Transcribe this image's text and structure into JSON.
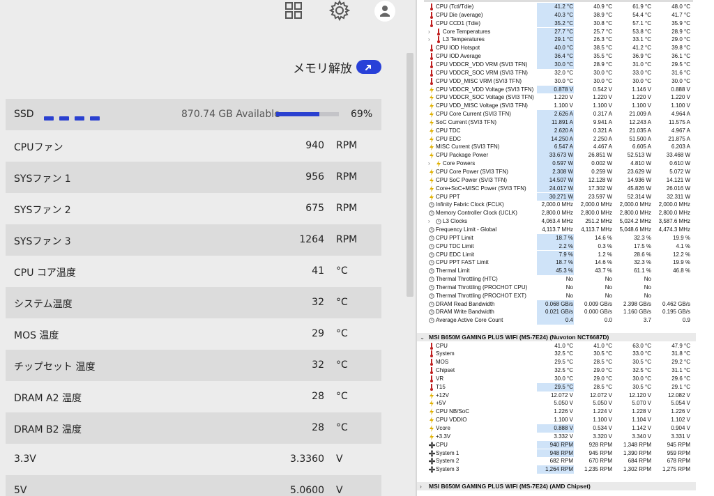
{
  "left": {
    "memory_release_label": "メモリ解放",
    "ssd": {
      "label": "SSD",
      "available": "870.74 GB Available",
      "percent": "69%",
      "fill_fraction": 0.69
    },
    "rows": [
      {
        "label": "CPUファン",
        "value": "940",
        "unit": "RPM"
      },
      {
        "label": "SYSファン 1",
        "value": "956",
        "unit": "RPM"
      },
      {
        "label": "SYSファン 2",
        "value": "675",
        "unit": "RPM"
      },
      {
        "label": "SYSファン 3",
        "value": "1264",
        "unit": "RPM"
      },
      {
        "label": "CPU コア温度",
        "value": "41",
        "unit": "°C"
      },
      {
        "label": "システム温度",
        "value": "32",
        "unit": "°C"
      },
      {
        "label": "MOS 温度",
        "value": "29",
        "unit": "°C"
      },
      {
        "label": "チップセット 温度",
        "value": "32",
        "unit": "°C"
      },
      {
        "label": "DRAM A2 温度",
        "value": "28",
        "unit": "°C"
      },
      {
        "label": "DRAM B2 温度",
        "value": "28",
        "unit": "°C"
      },
      {
        "label": "3.3V",
        "value": "3.3360",
        "unit": "V"
      },
      {
        "label": "5V",
        "value": "5.0600",
        "unit": "V"
      }
    ],
    "icons": [
      "grid-icon",
      "gear-icon",
      "user-avatar-icon",
      "upload-arrow-icon"
    ]
  },
  "right": {
    "cpu_rows": [
      {
        "label": "CPU (Tctl/Tdie)",
        "icon": "thermometer",
        "v": [
          "41.2 °C",
          "40.9 °C",
          "61.9 °C",
          "48.0 °C"
        ],
        "hl": true
      },
      {
        "label": "CPU Die (average)",
        "icon": "thermometer",
        "v": [
          "40.3 °C",
          "38.9 °C",
          "54.4 °C",
          "41.7 °C"
        ],
        "hl": true
      },
      {
        "label": "CPU CCD1 (Tdie)",
        "icon": "thermometer",
        "v": [
          "35.2 °C",
          "30.8 °C",
          "57.1 °C",
          "35.9 °C"
        ],
        "hl": true
      },
      {
        "label": "Core Temperatures",
        "icon": "thermometer",
        "exp": true,
        "v": [
          "27.7 °C",
          "25.7 °C",
          "53.8 °C",
          "28.9 °C"
        ],
        "hl": true
      },
      {
        "label": "L3 Temperatures",
        "icon": "thermometer",
        "exp": true,
        "v": [
          "29.1 °C",
          "26.3 °C",
          "33.1 °C",
          "29.0 °C"
        ],
        "hl": true
      },
      {
        "label": "CPU IOD Hotspot",
        "icon": "thermometer",
        "v": [
          "40.0 °C",
          "38.5 °C",
          "41.2 °C",
          "39.8 °C"
        ],
        "hl": true
      },
      {
        "label": "CPU IOD Average",
        "icon": "thermometer",
        "v": [
          "36.4 °C",
          "35.5 °C",
          "36.9 °C",
          "36.1 °C"
        ],
        "hl": true
      },
      {
        "label": "CPU VDDCR_VDD VRM (SVI3 TFN)",
        "icon": "thermometer",
        "v": [
          "30.0 °C",
          "28.9 °C",
          "31.0 °C",
          "29.5 °C"
        ],
        "hl": true
      },
      {
        "label": "CPU VDDCR_SOC VRM (SVI3 TFN)",
        "icon": "thermometer",
        "v": [
          "32.0 °C",
          "30.0 °C",
          "33.0 °C",
          "31.6 °C"
        ],
        "hl": false
      },
      {
        "label": "CPU VDD_MISC VRM (SVI3 TFN)",
        "icon": "thermometer",
        "v": [
          "30.0 °C",
          "30.0 °C",
          "30.0 °C",
          "30.0 °C"
        ],
        "hl": false
      },
      {
        "label": "CPU VDDCR_VDD Voltage (SVI3 TFN)",
        "icon": "bolt",
        "v": [
          "0.878 V",
          "0.542 V",
          "1.146 V",
          "0.888 V"
        ],
        "hl": true
      },
      {
        "label": "CPU VDDCR_SOC Voltage (SVI3 TFN)",
        "icon": "bolt",
        "v": [
          "1.220 V",
          "1.220 V",
          "1.220 V",
          "1.220 V"
        ],
        "hl": false
      },
      {
        "label": "CPU VDD_MISC Voltage (SVI3 TFN)",
        "icon": "bolt",
        "v": [
          "1.100 V",
          "1.100 V",
          "1.100 V",
          "1.100 V"
        ],
        "hl": false
      },
      {
        "label": "CPU Core Current (SVI3 TFN)",
        "icon": "bolt",
        "v": [
          "2.626 A",
          "0.317 A",
          "21.009 A",
          "4.964 A"
        ],
        "hl": true
      },
      {
        "label": "SoC Current (SVI3 TFN)",
        "icon": "bolt",
        "v": [
          "11.891 A",
          "9.941 A",
          "12.243 A",
          "11.575 A"
        ],
        "hl": true
      },
      {
        "label": "CPU TDC",
        "icon": "bolt",
        "v": [
          "2.620 A",
          "0.321 A",
          "21.035 A",
          "4.967 A"
        ],
        "hl": true
      },
      {
        "label": "CPU EDC",
        "icon": "bolt",
        "v": [
          "14.250 A",
          "2.250 A",
          "51.500 A",
          "21.875 A"
        ],
        "hl": true
      },
      {
        "label": "MISC Current (SVI3 TFN)",
        "icon": "bolt",
        "v": [
          "6.547 A",
          "4.467 A",
          "6.605 A",
          "6.203 A"
        ],
        "hl": true
      },
      {
        "label": "CPU Package Power",
        "icon": "bolt",
        "v": [
          "33.673 W",
          "26.851 W",
          "52.513 W",
          "33.468 W"
        ],
        "hl": true
      },
      {
        "label": "Core Powers",
        "icon": "bolt",
        "exp": true,
        "v": [
          "0.597 W",
          "0.002 W",
          "4.810 W",
          "0.610 W"
        ],
        "hl": true
      },
      {
        "label": "CPU Core Power (SVI3 TFN)",
        "icon": "bolt",
        "v": [
          "2.308 W",
          "0.259 W",
          "23.629 W",
          "5.072 W"
        ],
        "hl": true
      },
      {
        "label": "CPU SoC Power (SVI3 TFN)",
        "icon": "bolt",
        "v": [
          "14.507 W",
          "12.128 W",
          "14.936 W",
          "14.121 W"
        ],
        "hl": true
      },
      {
        "label": "Core+SoC+MISC Power (SVI3 TFN)",
        "icon": "bolt",
        "v": [
          "24.017 W",
          "17.302 W",
          "45.826 W",
          "26.016 W"
        ],
        "hl": true
      },
      {
        "label": "CPU PPT",
        "icon": "bolt",
        "v": [
          "30.271 W",
          "23.597 W",
          "52.314 W",
          "32.311 W"
        ],
        "hl": true
      },
      {
        "label": "Infinity Fabric Clock (FCLK)",
        "icon": "clock",
        "v": [
          "2,000.0 MHz",
          "2,000.0 MHz",
          "2,000.0 MHz",
          "2,000.0 MHz"
        ],
        "hl": false
      },
      {
        "label": "Memory Controller Clock (UCLK)",
        "icon": "clock",
        "v": [
          "2,800.0 MHz",
          "2,800.0 MHz",
          "2,800.0 MHz",
          "2,800.0 MHz"
        ],
        "hl": false
      },
      {
        "label": "L3 Clocks",
        "icon": "clock",
        "exp": true,
        "v": [
          "4,063.4 MHz",
          "251.2 MHz",
          "5,024.2 MHz",
          "3,587.6 MHz"
        ],
        "hl": false
      },
      {
        "label": "Frequency Limit - Global",
        "icon": "clock",
        "v": [
          "4,113.7 MHz",
          "4,113.7 MHz",
          "5,048.6 MHz",
          "4,474.3 MHz"
        ],
        "hl": false
      },
      {
        "label": "CPU PPT Limit",
        "icon": "clock",
        "v": [
          "18.7 %",
          "14.6 %",
          "32.3 %",
          "19.9 %"
        ],
        "hl": true
      },
      {
        "label": "CPU TDC Limit",
        "icon": "clock",
        "v": [
          "2.2 %",
          "0.3 %",
          "17.5 %",
          "4.1 %"
        ],
        "hl": true
      },
      {
        "label": "CPU EDC Limit",
        "icon": "clock",
        "v": [
          "7.9 %",
          "1.2 %",
          "28.6 %",
          "12.2 %"
        ],
        "hl": true
      },
      {
        "label": "CPU PPT FAST Limit",
        "icon": "clock",
        "v": [
          "18.7 %",
          "14.6 %",
          "32.3 %",
          "19.9 %"
        ],
        "hl": true
      },
      {
        "label": "Thermal Limit",
        "icon": "clock",
        "v": [
          "45.3 %",
          "43.7 %",
          "61.1 %",
          "46.8 %"
        ],
        "hl": true
      },
      {
        "label": "Thermal Throttling (HTC)",
        "icon": "clock",
        "v": [
          "No",
          "No",
          "No",
          ""
        ],
        "hl": false
      },
      {
        "label": "Thermal Throttling (PROCHOT CPU)",
        "icon": "clock",
        "v": [
          "No",
          "No",
          "No",
          ""
        ],
        "hl": false
      },
      {
        "label": "Thermal Throttling (PROCHOT EXT)",
        "icon": "clock",
        "v": [
          "No",
          "No",
          "No",
          ""
        ],
        "hl": false
      },
      {
        "label": "DRAM Read Bandwidth",
        "icon": "clock",
        "v": [
          "0.068 GB/s",
          "0.009 GB/s",
          "2.398 GB/s",
          "0.462 GB/s"
        ],
        "hl": true
      },
      {
        "label": "DRAM Write Bandwidth",
        "icon": "clock",
        "v": [
          "0.021 GB/s",
          "0.000 GB/s",
          "1.160 GB/s",
          "0.195 GB/s"
        ],
        "hl": true
      },
      {
        "label": "Average Active Core Count",
        "icon": "clock",
        "v": [
          "0.4",
          "0.0",
          "3.7",
          "0.9"
        ],
        "hl": true
      }
    ],
    "mb_header": "MSI B650M GAMING PLUS WIFI (MS-7E24) (Nuvoton NCT6687D)",
    "mb_rows": [
      {
        "label": "CPU",
        "icon": "thermometer",
        "v": [
          "41.0 °C",
          "41.0 °C",
          "63.0 °C",
          "47.9 °C"
        ],
        "hl": false
      },
      {
        "label": "System",
        "icon": "thermometer",
        "v": [
          "32.5 °C",
          "30.5 °C",
          "33.0 °C",
          "31.8 °C"
        ],
        "hl": false
      },
      {
        "label": "MOS",
        "icon": "thermometer",
        "v": [
          "29.5 °C",
          "28.5 °C",
          "30.5 °C",
          "29.2 °C"
        ],
        "hl": false
      },
      {
        "label": "Chipset",
        "icon": "thermometer",
        "v": [
          "32.5 °C",
          "29.0 °C",
          "32.5 °C",
          "31.1 °C"
        ],
        "hl": false
      },
      {
        "label": "VR",
        "icon": "thermometer",
        "v": [
          "30.0 °C",
          "29.0 °C",
          "30.0 °C",
          "29.6 °C"
        ],
        "hl": false
      },
      {
        "label": "T15",
        "icon": "thermometer",
        "v": [
          "29.5 °C",
          "28.5 °C",
          "30.5 °C",
          "29.1 °C"
        ],
        "hl": true
      },
      {
        "label": "+12V",
        "icon": "bolt",
        "v": [
          "12.072 V",
          "12.072 V",
          "12.120 V",
          "12.082 V"
        ],
        "hl": false
      },
      {
        "label": "+5V",
        "icon": "bolt",
        "v": [
          "5.050 V",
          "5.050 V",
          "5.070 V",
          "5.054 V"
        ],
        "hl": false
      },
      {
        "label": "CPU NB/SoC",
        "icon": "bolt",
        "v": [
          "1.226 V",
          "1.224 V",
          "1.228 V",
          "1.226 V"
        ],
        "hl": false
      },
      {
        "label": "CPU VDDIO",
        "icon": "bolt",
        "v": [
          "1.100 V",
          "1.100 V",
          "1.104 V",
          "1.102 V"
        ],
        "hl": false
      },
      {
        "label": "Vcore",
        "icon": "bolt",
        "v": [
          "0.888 V",
          "0.534 V",
          "1.142 V",
          "0.904 V"
        ],
        "hl": true
      },
      {
        "label": "+3.3V",
        "icon": "bolt",
        "v": [
          "3.332 V",
          "3.320 V",
          "3.340 V",
          "3.331 V"
        ],
        "hl": false
      },
      {
        "label": "CPU",
        "icon": "fan",
        "v": [
          "940 RPM",
          "928 RPM",
          "1,348 RPM",
          "945 RPM"
        ],
        "hl": true
      },
      {
        "label": "System 1",
        "icon": "fan",
        "v": [
          "948 RPM",
          "945 RPM",
          "1,390 RPM",
          "959 RPM"
        ],
        "hl": true
      },
      {
        "label": "System 2",
        "icon": "fan",
        "v": [
          "682 RPM",
          "670 RPM",
          "684 RPM",
          "678 RPM"
        ],
        "hl": false
      },
      {
        "label": "System 3",
        "icon": "fan",
        "v": [
          "1,264 RPM",
          "1,235 RPM",
          "1,302 RPM",
          "1,275 RPM"
        ],
        "hl": true
      }
    ],
    "chipset_header": "MSI B650M GAMING PLUS WIFI (MS-7E24) (AMD Chipset)",
    "colors": {
      "highlight": "#cfe3f8",
      "accent": "#2a40d0",
      "thermometer": "#c02020",
      "bolt": "#e0b000"
    }
  }
}
